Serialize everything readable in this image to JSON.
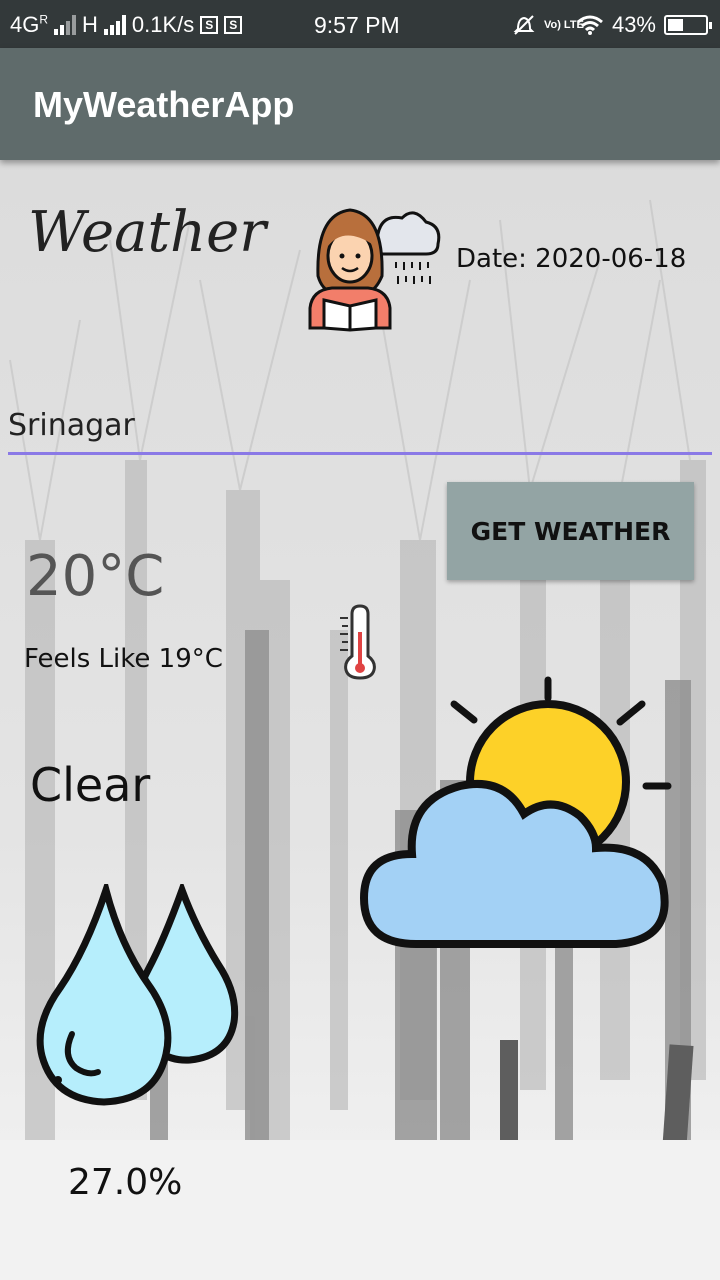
{
  "status_bar": {
    "network": "4G",
    "network_sup": "R",
    "network2": "H",
    "speed": "0.1K/s",
    "sim1": "S",
    "sim2": "S",
    "time": "9:57 PM",
    "volte": "Vo) LTE",
    "battery": "43%",
    "battery_level": 0.43
  },
  "app_bar": {
    "title": "MyWeatherApp"
  },
  "header": {
    "logo_text": "Weather",
    "date": "Date: 2020-06-18"
  },
  "search": {
    "city_value": "Srinagar"
  },
  "actions": {
    "get_weather": "GET WEATHER"
  },
  "weather": {
    "temperature": "20°C",
    "feels_like": "Feels Like 19°C",
    "condition": "Clear",
    "humidity": "27.0%"
  },
  "icons": {
    "girl": "girl-reading-rain-icon",
    "thermometer": "thermometer-icon",
    "weather": "sun-cloud-icon",
    "humidity": "water-drops-icon"
  },
  "colors": {
    "app_bar": "#5f6b6b",
    "status_bar": "#33393a",
    "underline": "#8a79e6",
    "button": "#93a4a4",
    "sun": "#fdd128",
    "cloud": "#a3d1f5",
    "drop": "#b6eefc"
  }
}
